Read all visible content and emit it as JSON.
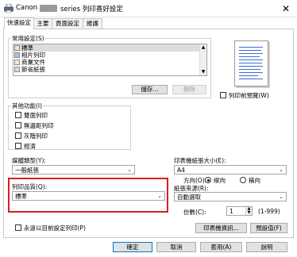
{
  "window": {
    "title_prefix": "Canon",
    "title_suffix": "series 列印喜好設定",
    "close_glyph": "✕"
  },
  "tabs": [
    "快速設定",
    "主要",
    "頁面設定",
    "維護"
  ],
  "common_settings": {
    "label": "常用設定(S)",
    "items": [
      "標準",
      "相片列印",
      "商業文件",
      "節省紙張"
    ],
    "selected_index": 0,
    "save_label": "儲存...",
    "delete_label": "刪除"
  },
  "preview_checkbox": {
    "label": "列印前預覽(W)",
    "checked": false
  },
  "other_features": {
    "label": "其他功能(I)",
    "items": [
      {
        "label": "雙面列印",
        "checked": false
      },
      {
        "label": "無邊距列印",
        "checked": false
      },
      {
        "label": "灰階列印",
        "checked": false
      },
      {
        "label": "經濟",
        "checked": false
      }
    ]
  },
  "media_type": {
    "label": "媒體類型(Y):",
    "value": "一般紙張"
  },
  "print_quality": {
    "label": "列印品質(Q):",
    "value": "標準"
  },
  "page_size": {
    "label": "印表機紙張大小(E):",
    "value": "A4"
  },
  "orientation": {
    "label": "方向(O):",
    "options": [
      "縱向",
      "橫向"
    ],
    "selected_index": 0
  },
  "paper_source": {
    "label": "紙張來源(R):",
    "value": "自動選取"
  },
  "copies": {
    "label": "份數(C):",
    "value": "1",
    "range": "(1-999)"
  },
  "always_print_checkbox": {
    "label": "永遠以目前設定列印(P)",
    "checked": false
  },
  "buttons": {
    "printer_info": "印表機資訊...",
    "defaults": "預設值(F)",
    "ok": "確定",
    "cancel": "取消",
    "apply": "套用(A)",
    "help": "說明"
  },
  "colors": {
    "highlight": "#d81e1e"
  }
}
